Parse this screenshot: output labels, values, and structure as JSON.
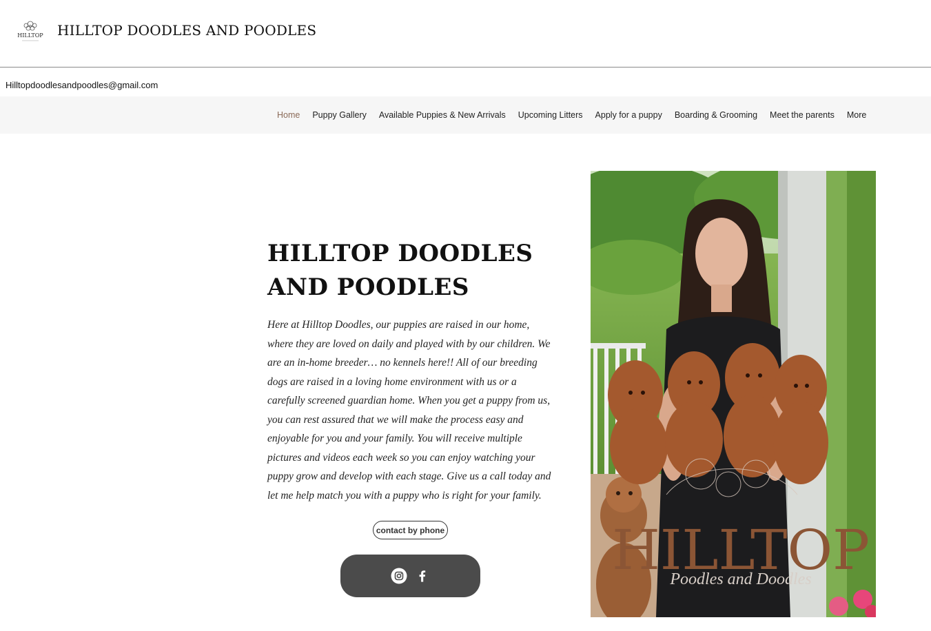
{
  "header": {
    "site_title": "HILLTOP DOODLES AND POODLES",
    "logo_icon": "hilltop-logo-icon",
    "logo_text": "HILLTOP"
  },
  "contact": {
    "email": "Hilltopdoodlesandpoodles@gmail.com"
  },
  "nav": {
    "items": [
      {
        "label": "Home",
        "active": true
      },
      {
        "label": "Puppy Gallery"
      },
      {
        "label": "Available Puppies & New Arrivals"
      },
      {
        "label": "Upcoming Litters"
      },
      {
        "label": "Apply for a puppy"
      },
      {
        "label": "Boarding & Grooming"
      },
      {
        "label": "Meet the parents"
      },
      {
        "label": "More"
      }
    ]
  },
  "hero": {
    "title": "HILLTOP DOODLES AND POODLES",
    "body": "Here at Hilltop Doodles, our puppies are raised in our home, where they are loved on daily and played with by our children. We are an in-home breeder… no kennels here!! All of our breeding dogs are raised in a loving home environment with us or a carefully screened guardian home. When you get a puppy from us, you can rest assured that we will make the process easy and enjoyable for you and your family.  You will receive multiple pictures and videos each week so you can enjoy watching your puppy grow and develop with each stage. Give us a call today and let me help match you with a puppy who is right for your family.",
    "contact_button": "contact by phone"
  },
  "social": {
    "icons": [
      "instagram-icon",
      "facebook-icon"
    ],
    "bar_color": "#4b4b4b"
  },
  "photo": {
    "brand_text": "HILLTOP",
    "brand_subtext": "Poodles and Doodles",
    "brand_color": "#8b5535"
  },
  "colors": {
    "nav_active": "#8a6a58",
    "nav_bg": "#f6f6f6"
  }
}
